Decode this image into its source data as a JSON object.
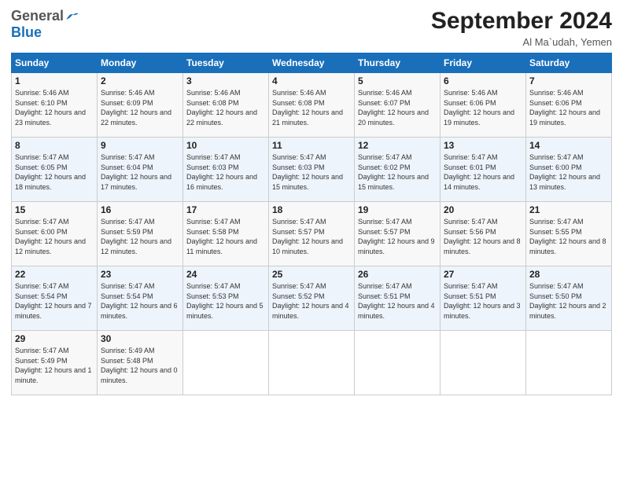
{
  "logo": {
    "general": "General",
    "blue": "Blue"
  },
  "header": {
    "month": "September 2024",
    "location": "Al Ma`udah, Yemen"
  },
  "weekdays": [
    "Sunday",
    "Monday",
    "Tuesday",
    "Wednesday",
    "Thursday",
    "Friday",
    "Saturday"
  ],
  "weeks": [
    [
      {
        "day": "1",
        "sunrise": "5:46 AM",
        "sunset": "6:10 PM",
        "daylight": "12 hours and 23 minutes."
      },
      {
        "day": "2",
        "sunrise": "5:46 AM",
        "sunset": "6:09 PM",
        "daylight": "12 hours and 22 minutes."
      },
      {
        "day": "3",
        "sunrise": "5:46 AM",
        "sunset": "6:08 PM",
        "daylight": "12 hours and 22 minutes."
      },
      {
        "day": "4",
        "sunrise": "5:46 AM",
        "sunset": "6:08 PM",
        "daylight": "12 hours and 21 minutes."
      },
      {
        "day": "5",
        "sunrise": "5:46 AM",
        "sunset": "6:07 PM",
        "daylight": "12 hours and 20 minutes."
      },
      {
        "day": "6",
        "sunrise": "5:46 AM",
        "sunset": "6:06 PM",
        "daylight": "12 hours and 19 minutes."
      },
      {
        "day": "7",
        "sunrise": "5:46 AM",
        "sunset": "6:06 PM",
        "daylight": "12 hours and 19 minutes."
      }
    ],
    [
      {
        "day": "8",
        "sunrise": "5:47 AM",
        "sunset": "6:05 PM",
        "daylight": "12 hours and 18 minutes."
      },
      {
        "day": "9",
        "sunrise": "5:47 AM",
        "sunset": "6:04 PM",
        "daylight": "12 hours and 17 minutes."
      },
      {
        "day": "10",
        "sunrise": "5:47 AM",
        "sunset": "6:03 PM",
        "daylight": "12 hours and 16 minutes."
      },
      {
        "day": "11",
        "sunrise": "5:47 AM",
        "sunset": "6:03 PM",
        "daylight": "12 hours and 15 minutes."
      },
      {
        "day": "12",
        "sunrise": "5:47 AM",
        "sunset": "6:02 PM",
        "daylight": "12 hours and 15 minutes."
      },
      {
        "day": "13",
        "sunrise": "5:47 AM",
        "sunset": "6:01 PM",
        "daylight": "12 hours and 14 minutes."
      },
      {
        "day": "14",
        "sunrise": "5:47 AM",
        "sunset": "6:00 PM",
        "daylight": "12 hours and 13 minutes."
      }
    ],
    [
      {
        "day": "15",
        "sunrise": "5:47 AM",
        "sunset": "6:00 PM",
        "daylight": "12 hours and 12 minutes."
      },
      {
        "day": "16",
        "sunrise": "5:47 AM",
        "sunset": "5:59 PM",
        "daylight": "12 hours and 12 minutes."
      },
      {
        "day": "17",
        "sunrise": "5:47 AM",
        "sunset": "5:58 PM",
        "daylight": "12 hours and 11 minutes."
      },
      {
        "day": "18",
        "sunrise": "5:47 AM",
        "sunset": "5:57 PM",
        "daylight": "12 hours and 10 minutes."
      },
      {
        "day": "19",
        "sunrise": "5:47 AM",
        "sunset": "5:57 PM",
        "daylight": "12 hours and 9 minutes."
      },
      {
        "day": "20",
        "sunrise": "5:47 AM",
        "sunset": "5:56 PM",
        "daylight": "12 hours and 8 minutes."
      },
      {
        "day": "21",
        "sunrise": "5:47 AM",
        "sunset": "5:55 PM",
        "daylight": "12 hours and 8 minutes."
      }
    ],
    [
      {
        "day": "22",
        "sunrise": "5:47 AM",
        "sunset": "5:54 PM",
        "daylight": "12 hours and 7 minutes."
      },
      {
        "day": "23",
        "sunrise": "5:47 AM",
        "sunset": "5:54 PM",
        "daylight": "12 hours and 6 minutes."
      },
      {
        "day": "24",
        "sunrise": "5:47 AM",
        "sunset": "5:53 PM",
        "daylight": "12 hours and 5 minutes."
      },
      {
        "day": "25",
        "sunrise": "5:47 AM",
        "sunset": "5:52 PM",
        "daylight": "12 hours and 4 minutes."
      },
      {
        "day": "26",
        "sunrise": "5:47 AM",
        "sunset": "5:51 PM",
        "daylight": "12 hours and 4 minutes."
      },
      {
        "day": "27",
        "sunrise": "5:47 AM",
        "sunset": "5:51 PM",
        "daylight": "12 hours and 3 minutes."
      },
      {
        "day": "28",
        "sunrise": "5:47 AM",
        "sunset": "5:50 PM",
        "daylight": "12 hours and 2 minutes."
      }
    ],
    [
      {
        "day": "29",
        "sunrise": "5:47 AM",
        "sunset": "5:49 PM",
        "daylight": "12 hours and 1 minute."
      },
      {
        "day": "30",
        "sunrise": "5:49 AM",
        "sunset": "5:48 PM",
        "daylight": "12 hours and 0 minutes."
      },
      null,
      null,
      null,
      null,
      null
    ]
  ],
  "labels": {
    "sunrise": "Sunrise:",
    "sunset": "Sunset:",
    "daylight": "Daylight:"
  }
}
